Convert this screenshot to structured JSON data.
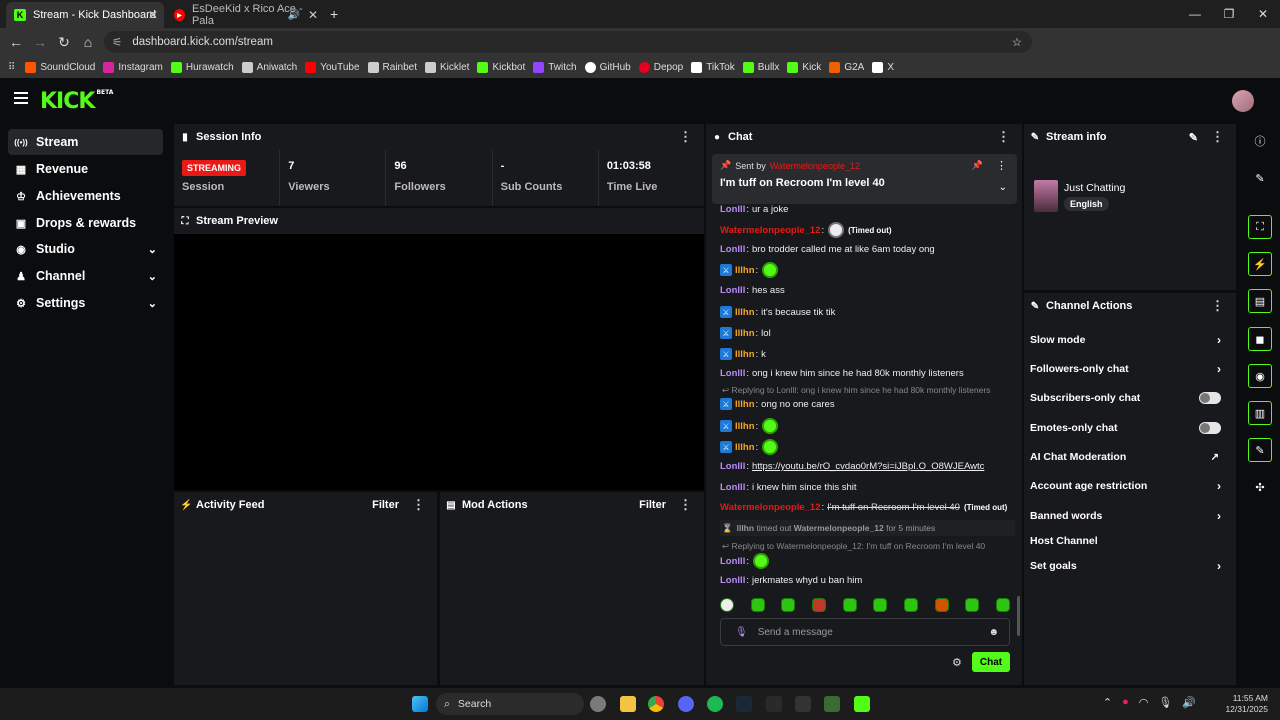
{
  "browser": {
    "tabs": [
      {
        "title": "Stream - Kick Dashboard",
        "favicon": "K",
        "color": "#53fc18"
      },
      {
        "title": "EsDeeKid x Rico Ace - Pala",
        "favicon": "▶",
        "color": "#ff0000"
      }
    ],
    "url": "dashboard.kick.com/stream",
    "bookmarks": [
      {
        "label": "SoundCloud",
        "color": "#ff5500"
      },
      {
        "label": "Instagram",
        "color": "#d6249f"
      },
      {
        "label": "Hurawatch",
        "color": "#53fc18"
      },
      {
        "label": "Aniwatch",
        "color": "#cccccc"
      },
      {
        "label": "YouTube",
        "color": "#ff0000"
      },
      {
        "label": "Rainbet",
        "color": "#cccccc"
      },
      {
        "label": "Kicklet",
        "color": "#cccccc"
      },
      {
        "label": "Kickbot",
        "color": "#53fc18"
      },
      {
        "label": "Twitch",
        "color": "#9146ff"
      },
      {
        "label": "GitHub",
        "color": "#ffffff"
      },
      {
        "label": "Depop",
        "color": "#e6001e"
      },
      {
        "label": "TikTok",
        "color": "#ffffff"
      },
      {
        "label": "Bullx",
        "color": "#53fc18"
      },
      {
        "label": "Kick",
        "color": "#53fc18"
      },
      {
        "label": "G2A",
        "color": "#f05f00"
      },
      {
        "label": "X",
        "color": "#ffffff"
      }
    ]
  },
  "app": {
    "logo": "KICK",
    "logo_tag": "BETA",
    "accent": "#53fc18"
  },
  "sidebar": {
    "items": [
      {
        "label": "Stream",
        "icon": "broadcast-icon",
        "glyph": "((•))",
        "selected": true
      },
      {
        "label": "Revenue",
        "icon": "revenue-icon",
        "glyph": "▦"
      },
      {
        "label": "Achievements",
        "icon": "trophy-icon",
        "glyph": "🏆"
      },
      {
        "label": "Drops & rewards",
        "icon": "gift-icon",
        "glyph": "🎁"
      },
      {
        "label": "Studio",
        "icon": "studio-icon",
        "glyph": "◉",
        "expandable": true
      },
      {
        "label": "Channel",
        "icon": "channel-icon",
        "glyph": "♟",
        "expandable": true
      },
      {
        "label": "Settings",
        "icon": "settings-icon",
        "glyph": "⚙",
        "expandable": true
      }
    ]
  },
  "session": {
    "title": "Session Info",
    "status": "STREAMING",
    "status_label": "Session",
    "stats": [
      {
        "value": "7",
        "label": "Viewers"
      },
      {
        "value": "96",
        "label": "Followers"
      },
      {
        "value": "-",
        "label": "Sub Counts"
      },
      {
        "value": "01:03:58",
        "label": "Time Live"
      }
    ]
  },
  "preview": {
    "title": "Stream Preview"
  },
  "activity": {
    "title": "Activity Feed",
    "filter": "Filter"
  },
  "modactions": {
    "title": "Mod Actions",
    "filter": "Filter"
  },
  "chat": {
    "title": "Chat",
    "pinned": {
      "prefix": "Sent by",
      "user": "Watermelonpeople_12",
      "text": "I'm tuff on Recroom I'm level 40"
    },
    "messages": [
      {
        "user": "Lonlll",
        "type": "lon",
        "text": "ur a joke"
      },
      {
        "user": "Watermelonpeople_12",
        "type": "wat",
        "text": "",
        "emote": "white",
        "timedout": "(Timed out)"
      },
      {
        "user": "Lonlll",
        "type": "lon",
        "text": "bro trodder called me at like 6am today ong"
      },
      {
        "user": "lllhn",
        "type": "ill",
        "mod": true,
        "text": "",
        "emote": "green"
      },
      {
        "user": "Lonlll",
        "type": "lon",
        "text": "hes ass"
      },
      {
        "user": "lllhn",
        "type": "ill",
        "mod": true,
        "text": "it's because tik tik"
      },
      {
        "user": "lllhn",
        "type": "ill",
        "mod": true,
        "text": "lol"
      },
      {
        "user": "lllhn",
        "type": "ill",
        "mod": true,
        "text": "k"
      },
      {
        "user": "Lonlll",
        "type": "lon",
        "text": "ong i knew him since he had 80k monthly listeners"
      },
      {
        "user": "lllhn",
        "type": "ill",
        "mod": true,
        "text": "ong no one cares",
        "reply": "Replying to Lonlll: ong i knew him since he had 80k monthly listeners"
      },
      {
        "user": "lllhn",
        "type": "ill",
        "mod": true,
        "text": "",
        "emote": "green"
      },
      {
        "user": "lllhn",
        "type": "ill",
        "mod": true,
        "text": "",
        "emote": "green"
      },
      {
        "user": "Lonlll",
        "type": "lon",
        "text": "https://youtu.be/rO_cvdao0rM?si=iJBpI.O_O8WJEAwtc",
        "link": true
      },
      {
        "user": "Lonlll",
        "type": "lon",
        "text": "i knew him since this shit"
      },
      {
        "user": "Watermelonpeople_12",
        "type": "wat",
        "text": "I'm tuff on Recroom I'm level 40",
        "strike": true,
        "timedout": "(Timed out)"
      },
      {
        "system": true,
        "actor": "lllhn",
        "action": "timed out",
        "target": "Watermelonpeople_12",
        "duration": "for 5 minutes"
      },
      {
        "user": "Lonlll",
        "type": "lon",
        "text": "",
        "emote": "green",
        "reply": "Replying to Watermelonpeople_12: I'm tuff on Recroom I'm level 40"
      },
      {
        "user": "Lonlll",
        "type": "lon",
        "text": "jerkmates whyd u ban him"
      }
    ],
    "input_placeholder": "Send a message",
    "send_label": "Chat"
  },
  "streaminfo": {
    "title": "Stream info",
    "category": "Just Chatting",
    "language": "English"
  },
  "channelactions": {
    "title": "Channel Actions",
    "items": [
      {
        "label": "Slow mode",
        "control": "chevron"
      },
      {
        "label": "Followers-only chat",
        "control": "chevron"
      },
      {
        "label": "Subscribers-only chat",
        "control": "toggle",
        "value": false
      },
      {
        "label": "Emotes-only chat",
        "control": "toggle",
        "value": false
      },
      {
        "label": "AI Chat Moderation",
        "control": "external"
      },
      {
        "label": "Account age restriction",
        "control": "chevron"
      },
      {
        "label": "Banned words",
        "control": "chevron"
      },
      {
        "label": "Host Channel",
        "control": "none"
      },
      {
        "label": "Set goals",
        "control": "chevron"
      }
    ]
  },
  "taskbar": {
    "search": "Search",
    "time": "11:55 AM",
    "date": "12/31/2025"
  }
}
